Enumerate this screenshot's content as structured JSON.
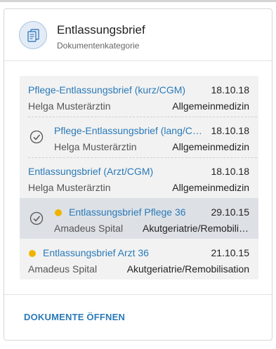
{
  "header": {
    "title": "Entlassungsbrief",
    "subtitle": "Dokumentenkategorie",
    "icon": "document-stack-icon"
  },
  "documents": [
    {
      "name": "Pflege-Entlassungsbrief (kurz/CGM)",
      "date": "18.10.18",
      "author": "Helga Musterärztin",
      "department": "Allgemeinmedizin",
      "checked": false,
      "new": false,
      "selected": false
    },
    {
      "name": "Pflege-Entlassungsbrief (lang/CGM)",
      "date": "18.10.18",
      "author": "Helga Musterärztin",
      "department": "Allgemeinmedizin",
      "checked": true,
      "new": false,
      "selected": false
    },
    {
      "name": "Entlassungsbrief (Arzt/CGM)",
      "date": "18.10.18",
      "author": "Helga Musterärztin",
      "department": "Allgemeinmedizin",
      "checked": false,
      "new": false,
      "selected": false
    },
    {
      "name": "Entlassungsbrief Pflege 36",
      "date": "29.10.15",
      "author": "Amadeus Spital",
      "department": "Akutgeriatrie/Remobilisation",
      "checked": true,
      "new": true,
      "selected": true
    },
    {
      "name": "Entlassungsbrief Arzt 36",
      "date": "21.10.15",
      "author": "Amadeus Spital",
      "department": "Akutgeriatrie/Remobilisation",
      "checked": false,
      "new": true,
      "selected": false
    }
  ],
  "footer": {
    "open_label": "DOKUMENTE ÖFFNEN"
  },
  "colors": {
    "accent": "#2a7ab8",
    "new_dot": "#f0b400",
    "selected_row": "#dde1e6"
  }
}
